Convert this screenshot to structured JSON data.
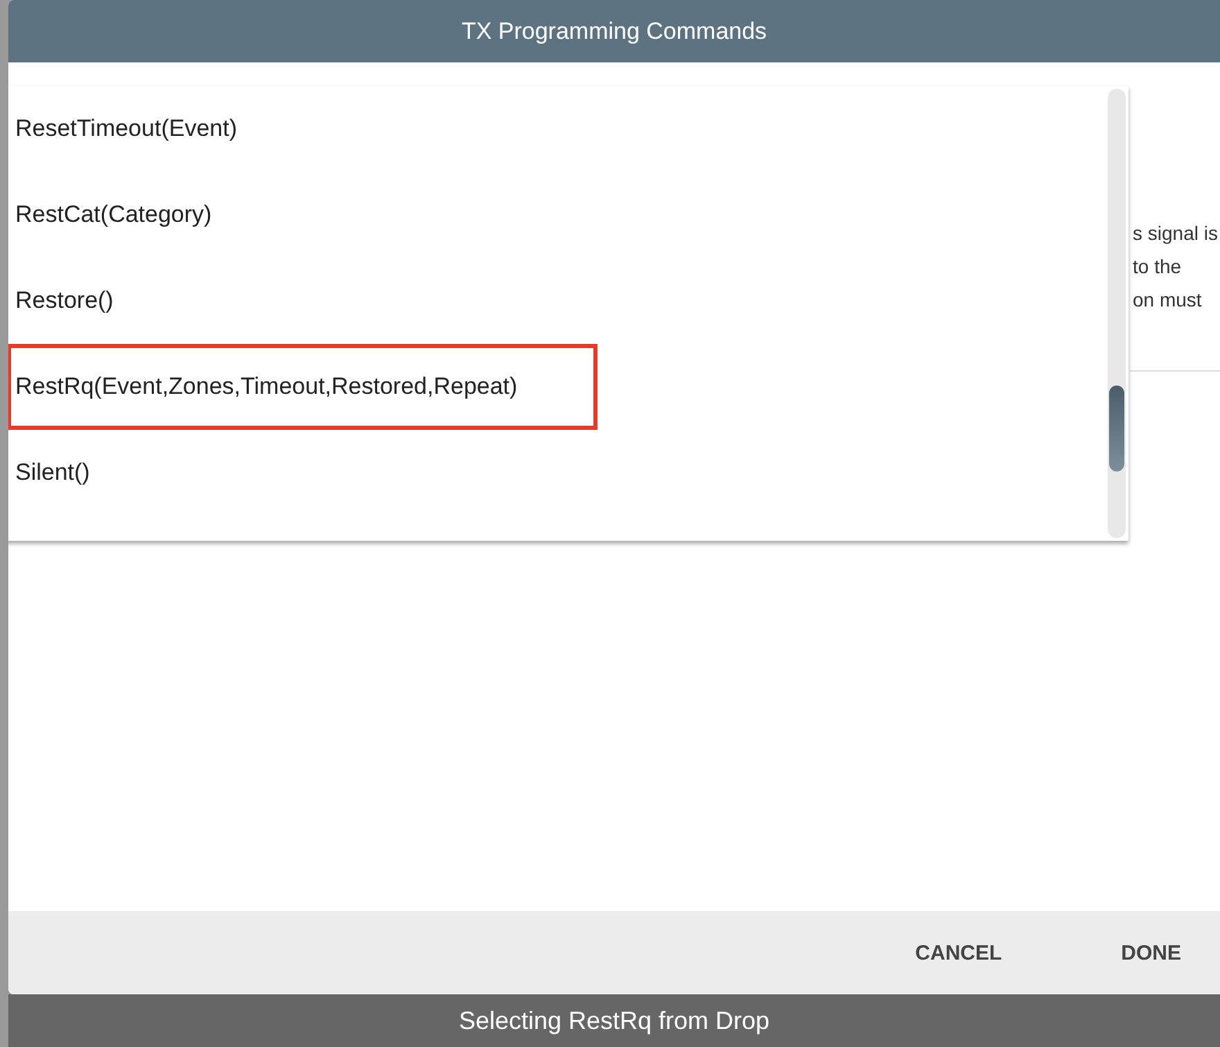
{
  "dialog": {
    "title": "TX Programming Commands",
    "background_text": [
      "s signal is",
      "to the",
      "on must"
    ],
    "dropdown": {
      "items": [
        {
          "label": "ResetTimeout(Event)",
          "selected": false
        },
        {
          "label": "RestCat(Category)",
          "selected": false
        },
        {
          "label": "Restore()",
          "selected": false
        },
        {
          "label": "RestRq(Event,Zones,Timeout,Restored,Repeat)",
          "selected": true
        },
        {
          "label": "Silent()",
          "selected": false
        }
      ]
    },
    "buttons": [
      "CANCEL",
      "DONE"
    ]
  },
  "caption": "Selecting RestRq from Drop"
}
